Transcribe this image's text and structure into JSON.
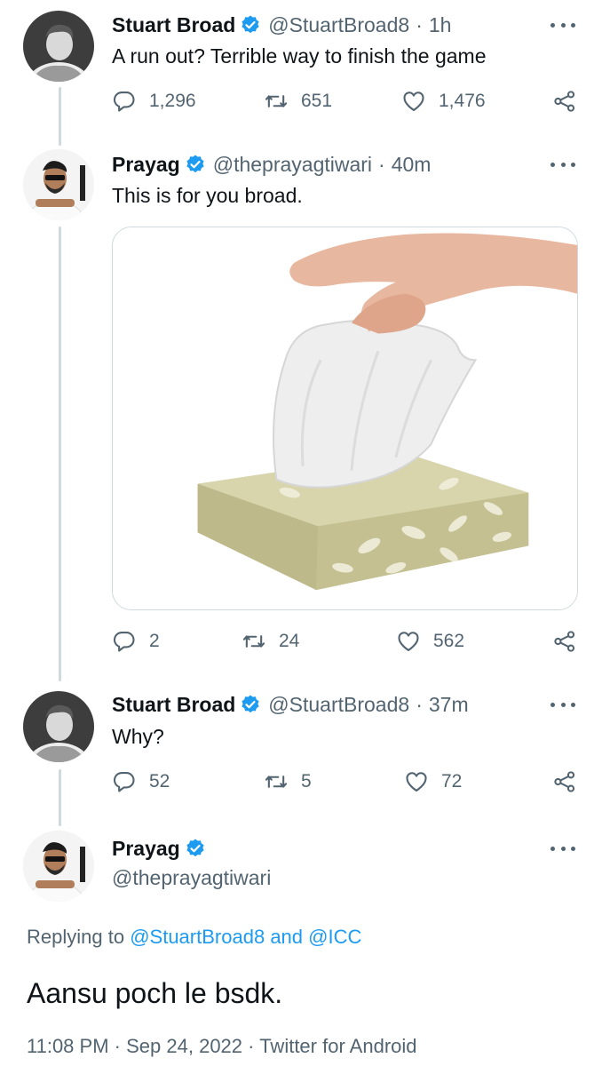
{
  "colors": {
    "verified": "#1d9bf0",
    "link": "#1d9bf0",
    "secondary": "#536471",
    "thread_line": "#cfd9de"
  },
  "tweets": [
    {
      "name": "Stuart Broad",
      "handle": "@StuartBroad8",
      "time": "1h",
      "text": "A run out? Terrible way to finish the game",
      "replies": "1,296",
      "retweets": "651",
      "likes": "1,476"
    },
    {
      "name": "Prayag",
      "handle": "@theprayagtiwari",
      "time": "40m",
      "text": "This is for you broad.",
      "replies": "2",
      "retweets": "24",
      "likes": "562",
      "media": "tissue-box-photo"
    },
    {
      "name": "Stuart Broad",
      "handle": "@StuartBroad8",
      "time": "37m",
      "text": "Why?",
      "replies": "52",
      "retweets": "5",
      "likes": "72"
    }
  ],
  "focused": {
    "name": "Prayag",
    "handle": "@theprayagtiwari",
    "replying_prefix": "Replying to",
    "reply_to_1": "@StuartBroad8",
    "reply_and": "and",
    "reply_to_2": "@ICC",
    "text": "Aansu poch le bsdk.",
    "time": "11:08 PM",
    "date": "Sep 24, 2022",
    "client": "Twitter for Android"
  },
  "icons": {
    "reply": "reply-icon",
    "retweet": "retweet-icon",
    "like": "heart-icon",
    "share": "share-icon",
    "verified": "verified-badge-icon",
    "more": "more-options-icon"
  }
}
